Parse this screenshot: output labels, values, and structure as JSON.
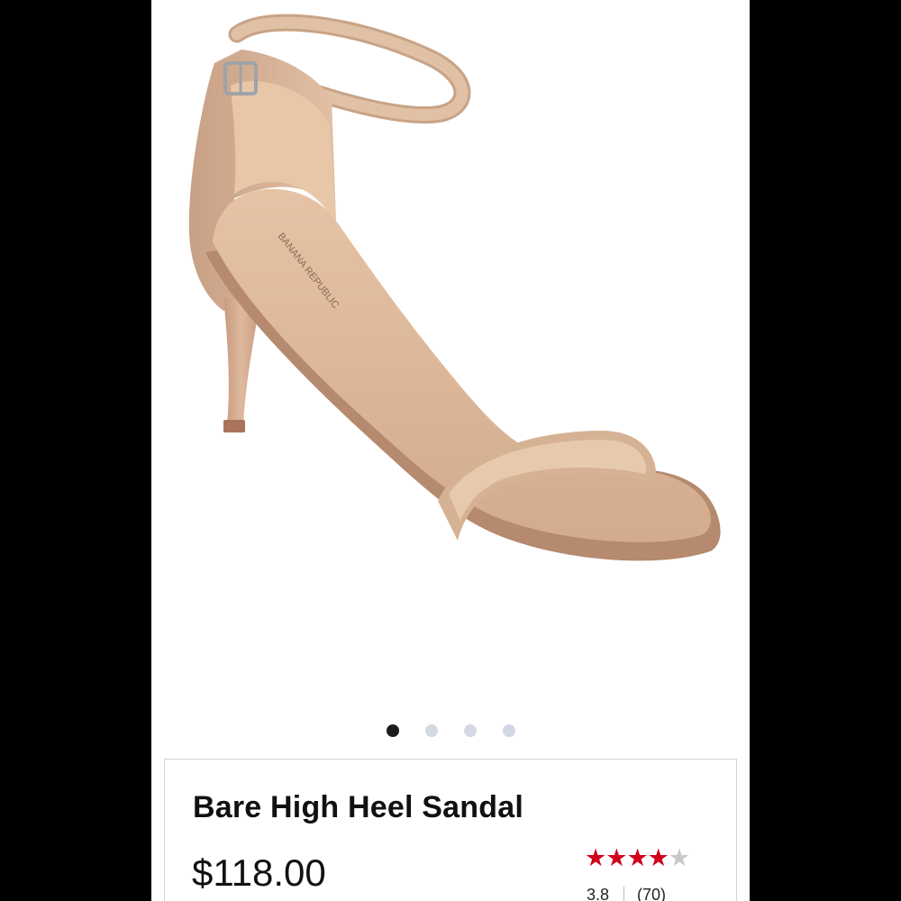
{
  "product": {
    "title": "Bare High Heel Sandal",
    "price": "$118.00",
    "rating": {
      "value": "3.8",
      "count": "(70)",
      "stars_filled": 4,
      "stars_total": 5
    },
    "image": {
      "insole_brand": "BANANA REPUBLIC"
    }
  },
  "carousel": {
    "total_images": 4,
    "active_index": 0
  },
  "colors": {
    "star_filled": "#d0021b",
    "star_empty": "#c8c8c8",
    "dot_active": "#1c1c1c",
    "dot_inactive": "#d4d8e4",
    "leather": "#d9b89c"
  }
}
